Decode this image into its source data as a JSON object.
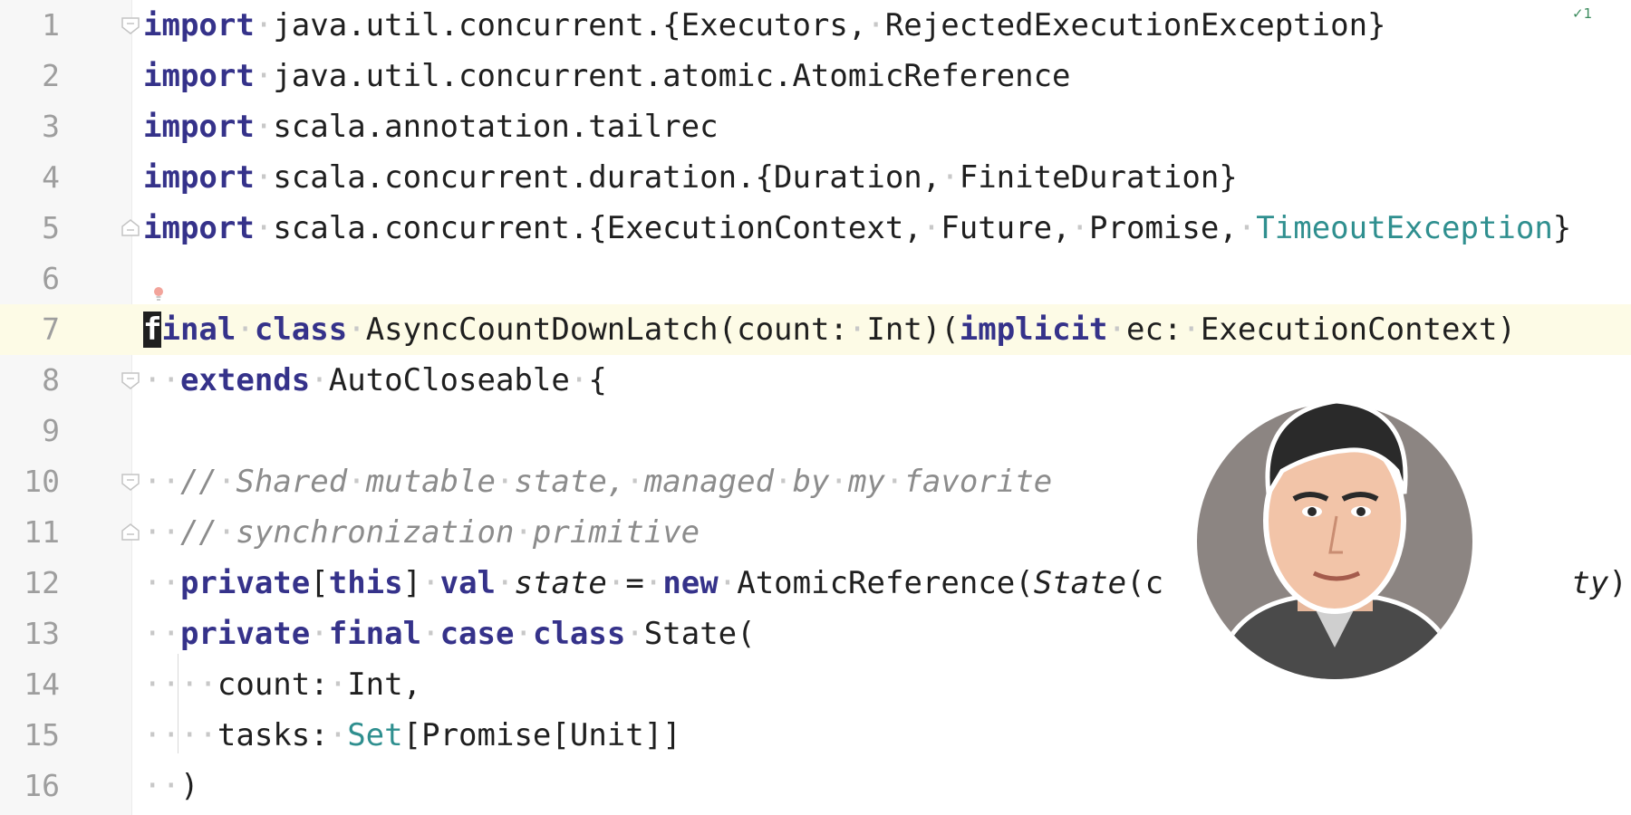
{
  "editor": {
    "inspection_widget": "✓1",
    "lines": [
      {
        "n": "1",
        "tokens": [
          {
            "t": "import",
            "c": "kw"
          },
          {
            "t": "·",
            "c": "ws"
          },
          {
            "t": "java.util.concurrent.{Executors,"
          },
          {
            "t": "·",
            "c": "ws"
          },
          {
            "t": "RejectedExecutionException}"
          }
        ]
      },
      {
        "n": "2",
        "tokens": [
          {
            "t": "import",
            "c": "kw"
          },
          {
            "t": "·",
            "c": "ws"
          },
          {
            "t": "java.util.concurrent.atomic.AtomicReference"
          }
        ]
      },
      {
        "n": "3",
        "tokens": [
          {
            "t": "import",
            "c": "kw"
          },
          {
            "t": "·",
            "c": "ws"
          },
          {
            "t": "scala.annotation.tailrec"
          }
        ]
      },
      {
        "n": "4",
        "tokens": [
          {
            "t": "import",
            "c": "kw"
          },
          {
            "t": "·",
            "c": "ws"
          },
          {
            "t": "scala.concurrent.duration.{Duration,"
          },
          {
            "t": "·",
            "c": "ws"
          },
          {
            "t": "FiniteDuration}"
          }
        ]
      },
      {
        "n": "5",
        "tokens": [
          {
            "t": "import",
            "c": "kw"
          },
          {
            "t": "·",
            "c": "ws"
          },
          {
            "t": "scala.concurrent.{ExecutionContext,"
          },
          {
            "t": "·",
            "c": "ws"
          },
          {
            "t": "Future,"
          },
          {
            "t": "·",
            "c": "ws"
          },
          {
            "t": "Promise,"
          },
          {
            "t": "·",
            "c": "ws"
          },
          {
            "t": "TimeoutException",
            "c": "teal"
          },
          {
            "t": "}"
          }
        ]
      },
      {
        "n": "6",
        "tokens": []
      },
      {
        "n": "7",
        "tokens": [
          {
            "t": "f",
            "c": "kw caret"
          },
          {
            "t": "inal",
            "c": "kw"
          },
          {
            "t": "·",
            "c": "ws"
          },
          {
            "t": "class",
            "c": "kw"
          },
          {
            "t": "·",
            "c": "ws"
          },
          {
            "t": "AsyncCountDownLatch(count:"
          },
          {
            "t": "·",
            "c": "ws"
          },
          {
            "t": "Int)("
          },
          {
            "t": "implicit",
            "c": "kw"
          },
          {
            "t": "·",
            "c": "ws"
          },
          {
            "t": "ec:"
          },
          {
            "t": "·",
            "c": "ws"
          },
          {
            "t": "ExecutionContext)"
          }
        ]
      },
      {
        "n": "8",
        "tokens": [
          {
            "t": "··",
            "c": "ws"
          },
          {
            "t": "extends",
            "c": "kw"
          },
          {
            "t": "·",
            "c": "ws"
          },
          {
            "t": "AutoCloseable"
          },
          {
            "t": "·",
            "c": "ws"
          },
          {
            "t": "{"
          }
        ]
      },
      {
        "n": "9",
        "tokens": []
      },
      {
        "n": "10",
        "tokens": [
          {
            "t": "··",
            "c": "ws"
          },
          {
            "t": "//",
            "c": "cm"
          },
          {
            "t": "·",
            "c": "ws"
          },
          {
            "t": "Shared",
            "c": "cm"
          },
          {
            "t": "·",
            "c": "ws"
          },
          {
            "t": "mutable",
            "c": "cm"
          },
          {
            "t": "·",
            "c": "ws"
          },
          {
            "t": "state,",
            "c": "cm"
          },
          {
            "t": "·",
            "c": "ws"
          },
          {
            "t": "managed",
            "c": "cm"
          },
          {
            "t": "·",
            "c": "ws"
          },
          {
            "t": "by",
            "c": "cm"
          },
          {
            "t": "·",
            "c": "ws"
          },
          {
            "t": "my",
            "c": "cm"
          },
          {
            "t": "·",
            "c": "ws"
          },
          {
            "t": "favorite",
            "c": "cm"
          }
        ]
      },
      {
        "n": "11",
        "tokens": [
          {
            "t": "··",
            "c": "ws"
          },
          {
            "t": "//",
            "c": "cm"
          },
          {
            "t": "·",
            "c": "ws"
          },
          {
            "t": "synchronization",
            "c": "cm"
          },
          {
            "t": "·",
            "c": "ws"
          },
          {
            "t": "primitive",
            "c": "cm"
          }
        ]
      },
      {
        "n": "12",
        "tokens": [
          {
            "t": "··",
            "c": "ws"
          },
          {
            "t": "private",
            "c": "kw"
          },
          {
            "t": "["
          },
          {
            "t": "this",
            "c": "kw"
          },
          {
            "t": "]"
          },
          {
            "t": "·",
            "c": "ws"
          },
          {
            "t": "val",
            "c": "kw"
          },
          {
            "t": "·",
            "c": "ws"
          },
          {
            "t": "state",
            "c": "it"
          },
          {
            "t": "·",
            "c": "ws"
          },
          {
            "t": "="
          },
          {
            "t": "·",
            "c": "ws"
          },
          {
            "t": "new",
            "c": "kw"
          },
          {
            "t": "·",
            "c": "ws"
          },
          {
            "t": "AtomicReference("
          },
          {
            "t": "State",
            "c": "it"
          },
          {
            "t": "(c"
          },
          {
            "t": "                      "
          },
          {
            "t": "ty",
            "c": "it"
          },
          {
            "t": "))"
          }
        ]
      },
      {
        "n": "13",
        "tokens": [
          {
            "t": "··",
            "c": "ws"
          },
          {
            "t": "private",
            "c": "kw"
          },
          {
            "t": "·",
            "c": "ws"
          },
          {
            "t": "final",
            "c": "kw"
          },
          {
            "t": "·",
            "c": "ws"
          },
          {
            "t": "case",
            "c": "kw"
          },
          {
            "t": "·",
            "c": "ws"
          },
          {
            "t": "class",
            "c": "kw"
          },
          {
            "t": "·",
            "c": "ws"
          },
          {
            "t": "State("
          }
        ]
      },
      {
        "n": "14",
        "tokens": [
          {
            "t": "····",
            "c": "ws"
          },
          {
            "t": "count:"
          },
          {
            "t": "·",
            "c": "ws"
          },
          {
            "t": "Int,"
          }
        ]
      },
      {
        "n": "15",
        "tokens": [
          {
            "t": "····",
            "c": "ws"
          },
          {
            "t": "tasks:"
          },
          {
            "t": "·",
            "c": "ws"
          },
          {
            "t": "Set",
            "c": "teal"
          },
          {
            "t": "[Promise[Unit]]"
          }
        ]
      },
      {
        "n": "16",
        "tokens": [
          {
            "t": "··",
            "c": "ws"
          },
          {
            "t": ")"
          }
        ]
      }
    ],
    "current_line": "7",
    "fold_markers": {
      "1": "open",
      "5": "close",
      "8": "open",
      "10": "open",
      "11": "close"
    }
  },
  "colors": {
    "keyword": "#35328a",
    "comment": "#8c8c8c",
    "teal": "#2f8f8f",
    "current_line_bg": "#fdfbe6",
    "gutter_bg": "#f7f7f7"
  }
}
